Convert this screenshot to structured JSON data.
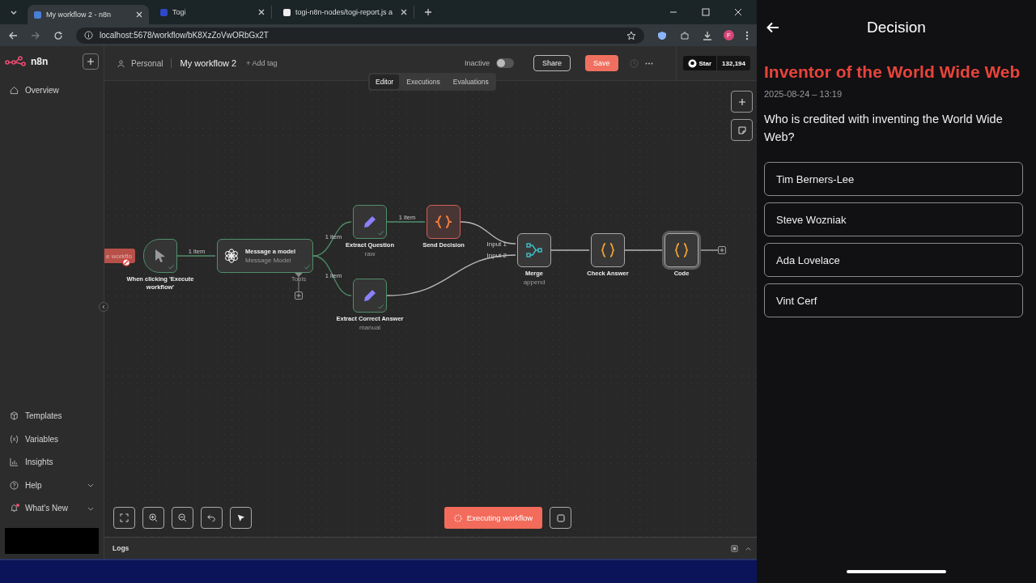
{
  "browser": {
    "tabs": [
      {
        "title": "My workflow 2 - n8n",
        "selected": true
      },
      {
        "title": "Togi",
        "selected": false
      },
      {
        "title": "togi-n8n-nodes/togi-report.js a",
        "selected": false
      }
    ],
    "url": "localhost:5678/workflow/bK8XzZoVwORbGx2T",
    "profile": "F"
  },
  "sidebar": {
    "brand": "n8n",
    "top_items": [
      {
        "label": "Overview"
      }
    ],
    "bottom_items": [
      {
        "label": "Templates",
        "has_menu": false,
        "badge": false
      },
      {
        "label": "Variables",
        "has_menu": false,
        "badge": false
      },
      {
        "label": "Insights",
        "has_menu": false,
        "badge": false
      },
      {
        "label": "Help",
        "has_menu": true,
        "badge": false
      },
      {
        "label": "What's New",
        "has_menu": true,
        "badge": true
      }
    ]
  },
  "header": {
    "project": "Personal",
    "workflow": "My workflow 2",
    "add_tag": "+ Add tag",
    "status_label": "Inactive",
    "active": false,
    "share": "Share",
    "save": "Save",
    "github": {
      "label": "Star",
      "count": "132,194"
    }
  },
  "view_tabs": [
    {
      "label": "Editor",
      "selected": true
    },
    {
      "label": "Executions",
      "selected": false
    },
    {
      "label": "Evaluations",
      "selected": false
    }
  ],
  "canvas": {
    "trigger_tag": "e workflo",
    "nodes": [
      {
        "title": "When clicking 'Execute workflow'",
        "kind": "trigger",
        "executed": true,
        "running": false,
        "selected": false
      },
      {
        "title": "Message a model",
        "subtitle": "Message Model",
        "kind": "model",
        "executed": true,
        "running": false,
        "selected": false
      },
      {
        "title": "Extract Question",
        "subtitle": "raw",
        "kind": "edit",
        "executed": true,
        "running": false,
        "selected": false
      },
      {
        "title": "Send Decision",
        "kind": "transform",
        "executed": false,
        "running": true,
        "selected": false
      },
      {
        "title": "Extract Correct Answer",
        "subtitle": "manual",
        "kind": "edit",
        "executed": true,
        "running": false,
        "selected": false
      },
      {
        "title": "Merge",
        "subtitle": "append",
        "kind": "merge",
        "executed": false,
        "running": false,
        "selected": false
      },
      {
        "title": "Check Answer",
        "kind": "code",
        "executed": false,
        "running": false,
        "selected": false
      },
      {
        "title": "Code",
        "kind": "code",
        "executed": false,
        "running": false,
        "selected": true
      }
    ],
    "edge_labels": [
      "1 item",
      "1 item",
      "1 item",
      "1 item"
    ],
    "port_labels": [
      "Input 1",
      "Input 2",
      "Tools"
    ]
  },
  "execute": {
    "label": "Executing workflow",
    "running": true
  },
  "logs": "Logs",
  "phone": {
    "title": "Decision",
    "heading": "Inventor of the World Wide Web",
    "date": "2025-08-24 – 13:19",
    "question": "Who is credited with inventing the World Wide Web?",
    "options": [
      "Tim Berners-Lee",
      "Steve Wozniak",
      "Ada Lovelace",
      "Vint Cerf"
    ]
  }
}
